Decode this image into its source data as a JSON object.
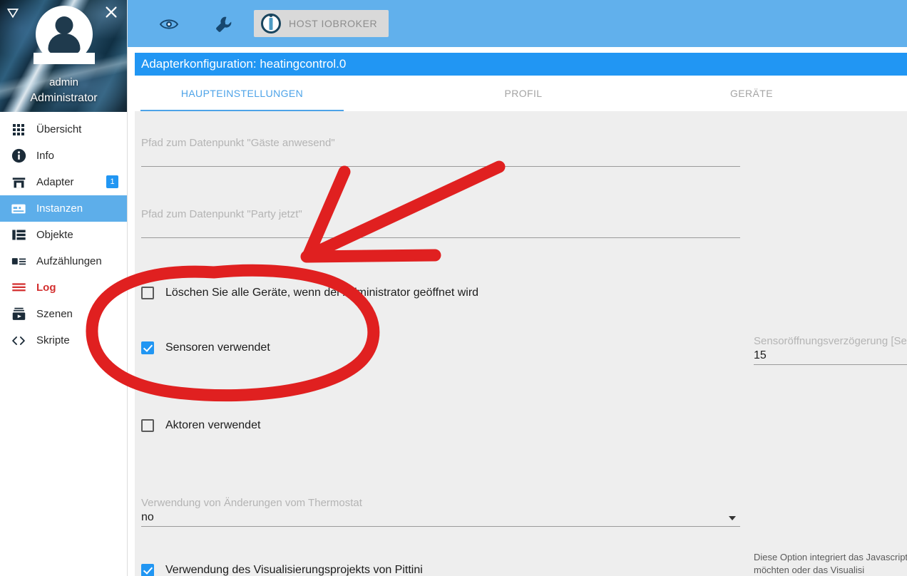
{
  "sidebar": {
    "user": {
      "name": "admin",
      "role": "Administrator"
    },
    "collapse_icon": "collapse-triangle-icon",
    "close_icon": "close-icon",
    "items": [
      {
        "label": "Übersicht",
        "icon": "grid-icon",
        "active": false,
        "badge": ""
      },
      {
        "label": "Info",
        "icon": "info-icon",
        "active": false,
        "badge": ""
      },
      {
        "label": "Adapter",
        "icon": "store-icon",
        "active": false,
        "badge": "1"
      },
      {
        "label": "Instanzen",
        "icon": "instances-icon",
        "active": true,
        "badge": ""
      },
      {
        "label": "Objekte",
        "icon": "list-icon",
        "active": false,
        "badge": ""
      },
      {
        "label": "Aufzählungen",
        "icon": "enum-icon",
        "active": false,
        "badge": ""
      },
      {
        "label": "Log",
        "icon": "log-lines-icon",
        "active": false,
        "badge": ""
      },
      {
        "label": "Szenen",
        "icon": "scenes-icon",
        "active": false,
        "badge": ""
      },
      {
        "label": "Skripte",
        "icon": "code-icon",
        "active": false,
        "badge": ""
      }
    ]
  },
  "topbar": {
    "eye_icon": "eye-icon",
    "wrench_icon": "wrench-icon",
    "host_chip_label": "HOST IOBROKER",
    "host_chip_icon": "iobroker-logo-icon",
    "background_color": "#61b0ec"
  },
  "config": {
    "title": "Adapterkonfiguration: heatingcontrol.0",
    "title_bar_color": "#2196f3",
    "tabs": [
      {
        "label": "HAUPTEINSTELLUNGEN",
        "active": true
      },
      {
        "label": "PROFIL",
        "active": false
      },
      {
        "label": "GERÄTE",
        "active": false
      }
    ],
    "fields": {
      "gaeste": {
        "label": "Pfad zum Datenpunkt \"Gäste anwesend\"",
        "value": ""
      },
      "party": {
        "label": "Pfad zum Datenpunkt \"Party jetzt\"",
        "value": ""
      },
      "thermostat": {
        "label": "Verwendung von Änderungen vom Thermostat",
        "value": "no"
      },
      "sensordelay": {
        "label": "Sensoröffnungsverzögerung [Sek.]",
        "value": "15"
      }
    },
    "checkboxes": {
      "delete_devices": {
        "label": "Löschen Sie alle Geräte, wenn der Administrator geöffnet wird",
        "checked": false
      },
      "sensors_used": {
        "label": "Sensoren verwendet",
        "checked": true
      },
      "actors_used": {
        "label": "Aktoren verwendet",
        "checked": false
      },
      "vis_project": {
        "label": "Verwendung des Visualisierungsprojekts von Pittini",
        "checked": true
      }
    },
    "help_text": "Diese Option integriert das Javascript-\nverwenden möchten oder das Visualisi",
    "accent_color": "#2196f3",
    "background_color": "#eeeeee"
  },
  "annotations": {
    "color": "#e02020",
    "shapes": [
      "ellipse-highlight-around-checkboxes",
      "arrow-pointing-down-left"
    ]
  }
}
